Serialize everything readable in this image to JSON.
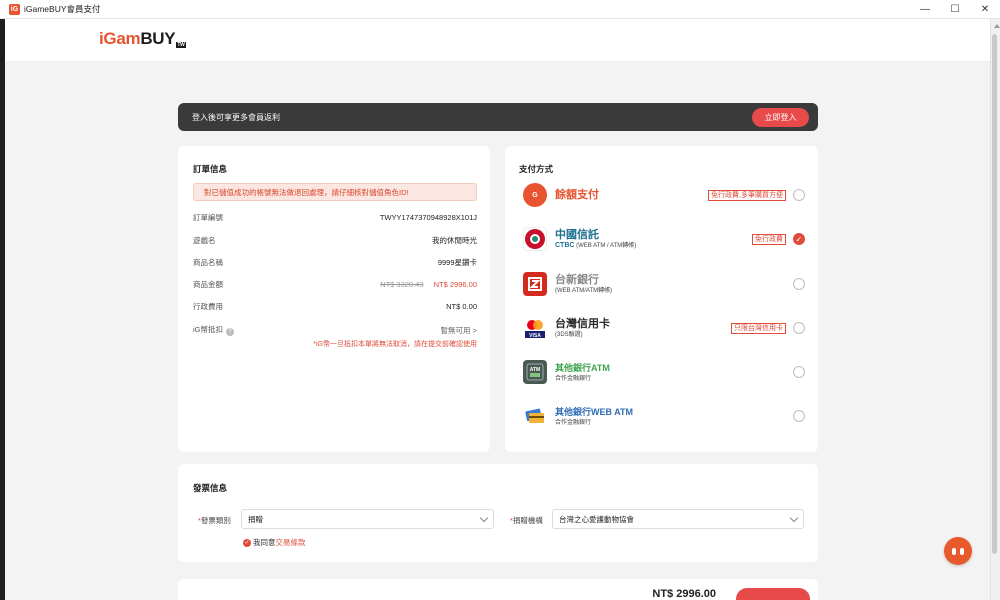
{
  "window": {
    "app_icon": "iG",
    "title": "iGameBUY會員支付",
    "controls": [
      "—",
      "☐",
      "✕"
    ]
  },
  "header": {
    "logo_part1": "iGam",
    "logo_part2": "BUY",
    "logo_tw": "TW"
  },
  "login_bar": {
    "text": "登入後可享更多會員返利",
    "button": "立即登入"
  },
  "order": {
    "title": "訂單信息",
    "warning": "對已儲值成功的帳號無法做退回處理，請仔細核對儲值角色ID!",
    "rows": [
      {
        "label": "訂單編號",
        "value": "TWYY1747370948928X101J"
      },
      {
        "label": "遊戲名",
        "value": "我的休閒時光"
      },
      {
        "label": "商品名稱",
        "value": "9999星鑽卡"
      },
      {
        "label": "商品金額",
        "original": "NT$ 3328.43",
        "value": "NT$ 2996.00"
      },
      {
        "label": "行政費用",
        "value": "NT$ 0.00"
      },
      {
        "label": "iG幣抵扣",
        "value": "暫無可用 >"
      }
    ],
    "help_icon": "?",
    "ig_note": "*iG幣一旦抵扣本單將無法取消，請在提交前確認使用"
  },
  "payment": {
    "title": "支付方式",
    "methods": [
      {
        "name": "餘額支付",
        "sub": "",
        "tag": "免行政費,多筆購買方便",
        "selected": false,
        "color": "#e8542f",
        "icon": "wallet-icon"
      },
      {
        "name": "中國信託",
        "sub_en": "CTBC",
        "sub": "(WEB ATM / ATM轉帳)",
        "tag": "免行政費",
        "selected": true,
        "color": "#c8102e",
        "icon": "ctbc-logo-icon"
      },
      {
        "name": "台新銀行",
        "sub": "(WEB ATM/ATM轉帳)",
        "tag": "",
        "selected": false,
        "color": "#d52b1e",
        "icon": "taishin-logo-icon"
      },
      {
        "name": "台灣信用卡",
        "sub": "(3DS驗證)",
        "tag": "只限台灣信用卡",
        "selected": false,
        "color": "#f79e1b",
        "icon": "credit-card-icon"
      },
      {
        "name": "其他銀行ATM",
        "sub": "合作金融銀行",
        "tag": "",
        "selected": false,
        "color": "#4caf50",
        "icon": "atm-icon"
      },
      {
        "name": "其他銀行WEB ATM",
        "sub": "合作金融銀行",
        "tag": "",
        "selected": false,
        "color": "#3a7bd5",
        "icon": "web-atm-icon"
      }
    ],
    "check": "✓"
  },
  "invoice": {
    "title": "發票信息",
    "type_label": "發票類別",
    "type_value": "捐贈",
    "org_label": "捐贈機構",
    "org_value": "台灣之心愛護動物協會",
    "agree_prefix": "我同意",
    "agree_link": "交易條款"
  },
  "bottom": {
    "total": "NT$ 2996.00"
  }
}
